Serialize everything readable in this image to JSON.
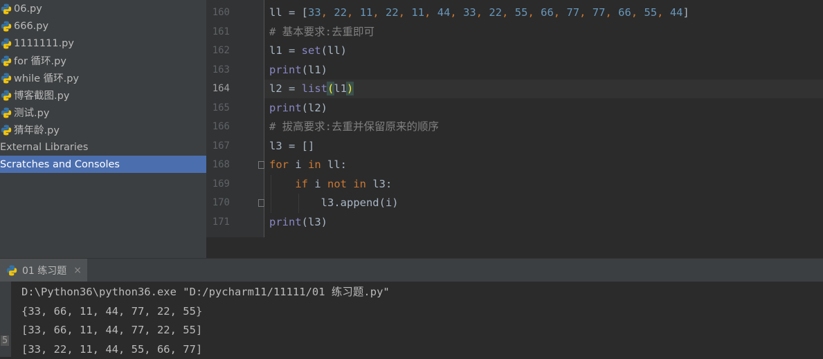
{
  "sidebar": {
    "items": [
      {
        "label": "06.py",
        "type": "python"
      },
      {
        "label": "666.py",
        "type": "python"
      },
      {
        "label": "1111111.py",
        "type": "python"
      },
      {
        "label": "for 循环.py",
        "type": "python"
      },
      {
        "label": "while 循环.py",
        "type": "python"
      },
      {
        "label": "博客截图.py",
        "type": "python"
      },
      {
        "label": "测试.py",
        "type": "python"
      },
      {
        "label": "猜年龄.py",
        "type": "python"
      },
      {
        "label": "External Libraries",
        "type": "folder"
      },
      {
        "label": "Scratches and Consoles",
        "type": "folder",
        "selected": true
      }
    ]
  },
  "editor": {
    "current_line": "164",
    "lines": [
      {
        "n": "160",
        "tokens": [
          [
            "v",
            "ll = "
          ],
          [
            "br",
            "["
          ],
          [
            "num",
            "33"
          ],
          [
            "kw",
            ", "
          ],
          [
            "num",
            "22"
          ],
          [
            "kw",
            ", "
          ],
          [
            "num",
            "11"
          ],
          [
            "kw",
            ", "
          ],
          [
            "num",
            "22"
          ],
          [
            "kw",
            ", "
          ],
          [
            "num",
            "11"
          ],
          [
            "kw",
            ", "
          ],
          [
            "num",
            "44"
          ],
          [
            "kw",
            ", "
          ],
          [
            "num",
            "33"
          ],
          [
            "kw",
            ", "
          ],
          [
            "num",
            "22"
          ],
          [
            "kw",
            ", "
          ],
          [
            "num",
            "55"
          ],
          [
            "kw",
            ", "
          ],
          [
            "num",
            "66"
          ],
          [
            "kw",
            ", "
          ],
          [
            "num",
            "77"
          ],
          [
            "kw",
            ", "
          ],
          [
            "num",
            "77"
          ],
          [
            "kw",
            ", "
          ],
          [
            "num",
            "66"
          ],
          [
            "kw",
            ", "
          ],
          [
            "num",
            "55"
          ],
          [
            "kw",
            ", "
          ],
          [
            "num",
            "44"
          ],
          [
            "br",
            "]"
          ]
        ]
      },
      {
        "n": "161",
        "tokens": [
          [
            "cm",
            "# 基本要求:去重即可"
          ]
        ]
      },
      {
        "n": "162",
        "tokens": [
          [
            "v",
            "l1 = "
          ],
          [
            "bi",
            "set"
          ],
          [
            "v",
            "(ll)"
          ]
        ]
      },
      {
        "n": "163",
        "tokens": [
          [
            "bi",
            "print"
          ],
          [
            "v",
            "(l1)"
          ]
        ]
      },
      {
        "n": "164",
        "tokens": [
          [
            "v",
            "l2 = "
          ],
          [
            "bi",
            "list"
          ],
          [
            "match",
            "("
          ],
          [
            "v",
            "l1"
          ],
          [
            "match",
            ")"
          ]
        ]
      },
      {
        "n": "165",
        "tokens": [
          [
            "bi",
            "print"
          ],
          [
            "v",
            "(l2)"
          ]
        ]
      },
      {
        "n": "166",
        "tokens": [
          [
            "cm",
            "# 拔高要求:去重并保留原来的顺序"
          ]
        ]
      },
      {
        "n": "167",
        "tokens": [
          [
            "v",
            "l3 = []"
          ]
        ]
      },
      {
        "n": "168",
        "tokens": [
          [
            "kw",
            "for "
          ],
          [
            "v",
            "i "
          ],
          [
            "kw",
            "in "
          ],
          [
            "v",
            "ll:"
          ]
        ]
      },
      {
        "n": "169",
        "tokens": [
          [
            "v",
            "    "
          ],
          [
            "kw",
            "if "
          ],
          [
            "v",
            "i "
          ],
          [
            "kw",
            "not in "
          ],
          [
            "v",
            "l3:"
          ]
        ]
      },
      {
        "n": "170",
        "tokens": [
          [
            "v",
            "        l3.append(i)"
          ]
        ]
      },
      {
        "n": "171",
        "tokens": [
          [
            "bi",
            "print"
          ],
          [
            "v",
            "(l3)"
          ]
        ]
      }
    ]
  },
  "run": {
    "tab_label": "01 练习题",
    "close_glyph": "×",
    "side_glyph": "5",
    "output": [
      "D:\\Python36\\python36.exe \"D:/pycharm11/11111/01 练习题.py\"",
      "{33, 66, 11, 44, 77, 22, 55}",
      "[33, 66, 11, 44, 77, 22, 55]",
      "[33, 22, 11, 44, 55, 66, 77]"
    ]
  },
  "icons": {
    "python_file": "python-file-icon",
    "run_tab": "python-run-icon",
    "close": "close-icon",
    "fold": "fold-marker-icon"
  }
}
